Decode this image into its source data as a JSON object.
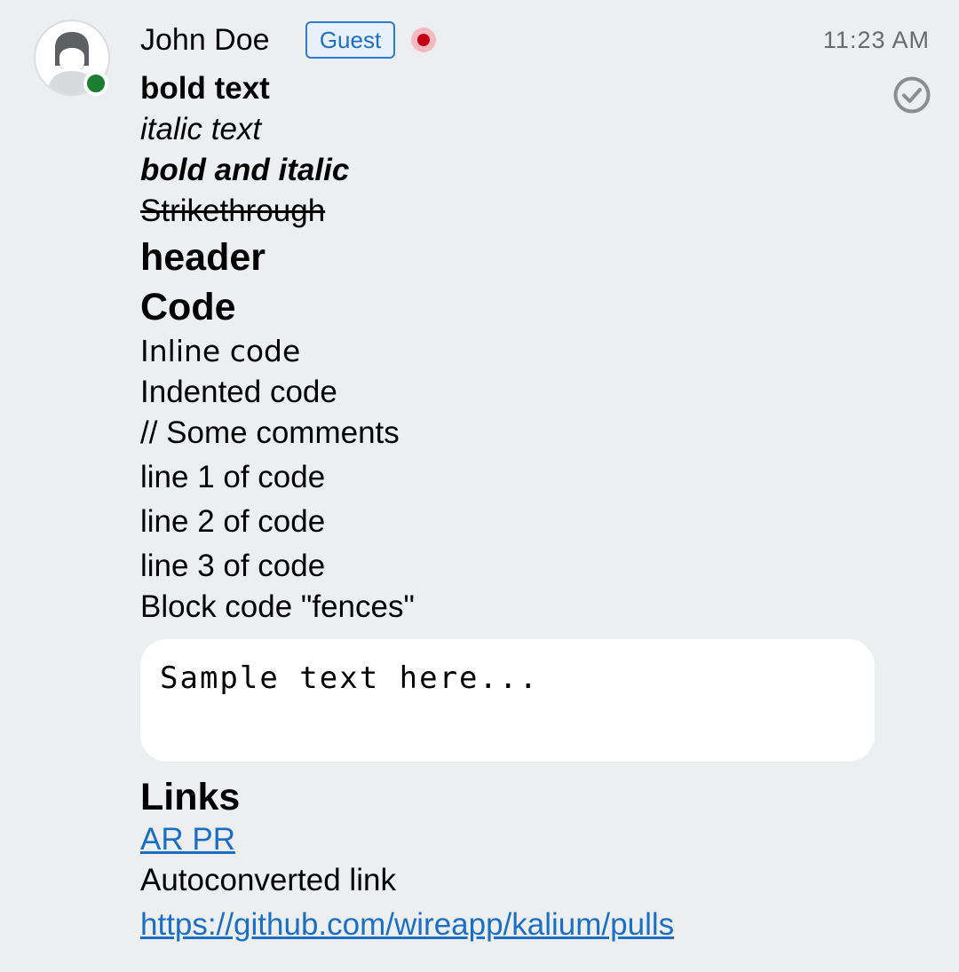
{
  "message": {
    "sender": "John Doe",
    "badge": "Guest",
    "timestamp": "11:23 AM",
    "status_icon": "delivered-check-icon",
    "lines": {
      "bold": "bold text",
      "italic": "italic text",
      "bold_italic": "bold and italic",
      "strike": "Strikethrough",
      "header": "header",
      "code_heading": "Code",
      "inline_code": "Inline code",
      "indented_code": "Indented code",
      "comment": "// Some comments",
      "line1": "line 1 of code",
      "line2": "line 2 of code",
      "line3": "line 3 of code",
      "fences": "Block code \"fences\"",
      "code_block": "Sample text here...",
      "links_heading": "Links",
      "link_text": "AR PR",
      "autoconverted": "Autoconverted link",
      "url": "https://github.com/wireapp/kalium/pulls"
    }
  },
  "colors": {
    "background": "#edeef0",
    "link": "#1a6fc4",
    "presence_online": "#1d7d32",
    "legal_hold": "#c20013",
    "guest_badge": "#2b7bd1"
  }
}
